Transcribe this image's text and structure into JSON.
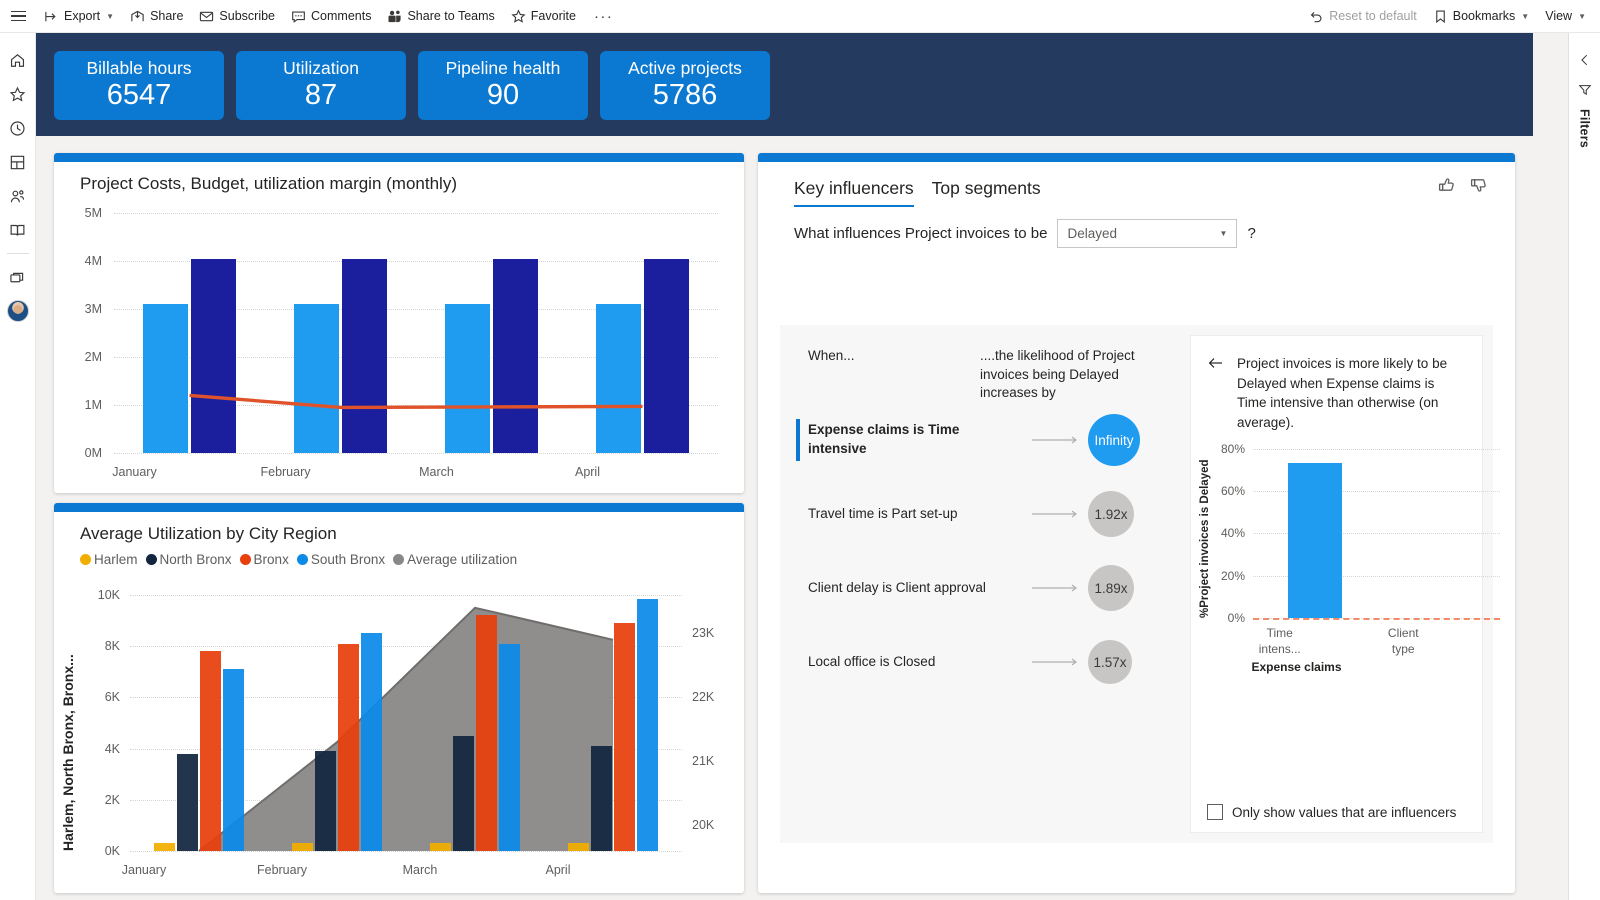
{
  "toolbar": {
    "menu": "menu-hamburger",
    "items": [
      {
        "label": "Export",
        "icon": "export-icon",
        "caret": true
      },
      {
        "label": "Share",
        "icon": "share-icon",
        "caret": false
      },
      {
        "label": "Subscribe",
        "icon": "mail-icon",
        "caret": false
      },
      {
        "label": "Comments",
        "icon": "comment-icon",
        "caret": false
      },
      {
        "label": "Share to Teams",
        "icon": "teams-icon",
        "caret": false
      },
      {
        "label": "Favorite",
        "icon": "star-icon",
        "caret": false
      }
    ],
    "overflow": "···",
    "right_items": [
      {
        "label": "Reset to default",
        "icon": "undo-icon",
        "caret": false,
        "disabled": true
      },
      {
        "label": "Bookmarks",
        "icon": "bookmark-icon",
        "caret": true,
        "disabled": false
      },
      {
        "label": "View",
        "icon": "",
        "caret": true,
        "disabled": false
      }
    ]
  },
  "left_rail": {
    "items": [
      {
        "name": "home-icon"
      },
      {
        "name": "star-icon"
      },
      {
        "name": "clock-icon"
      },
      {
        "name": "apps-icon"
      },
      {
        "name": "shared-people-icon"
      },
      {
        "name": "learn-book-icon"
      },
      {
        "name": "workspaces-icon"
      }
    ],
    "avatar": "user-avatar"
  },
  "right_rail": {
    "collapse": "chevron-left-icon",
    "filter_icon": "filter-funnel-icon",
    "label": "Filters"
  },
  "kpis": [
    {
      "title": "Billable hours",
      "value": "6547"
    },
    {
      "title": "Utilization",
      "value": "87"
    },
    {
      "title": "Pipeline health",
      "value": "90"
    },
    {
      "title": "Active projects",
      "value": "5786"
    }
  ],
  "colors": {
    "banner": "#243a5e",
    "accent": "#0b78d1",
    "kpi_card": "#0b78d1",
    "bar_light_blue": "#1f9cf0",
    "bar_navy": "#1b1f9e",
    "line_orange": "#e0532a",
    "harlem": "#f2ae00",
    "north_bronx": "#12263f",
    "bronx": "#e8400c",
    "south_bronx": "#0b8ae8",
    "average": "#8a8886",
    "bubble_blue": "#1f9cf0",
    "bubble_gray": "#c8c6c4"
  },
  "chart_data": [
    {
      "type": "bar",
      "id": "project-costs",
      "title": "Project Costs, Budget, utilization margin (monthly)",
      "categories": [
        "January",
        "February",
        "March",
        "April"
      ],
      "ylabel": "",
      "xlabel": "",
      "ylim": [
        0,
        5000000
      ],
      "yticks": [
        "0M",
        "1M",
        "2M",
        "3M",
        "4M",
        "5M"
      ],
      "ytick_values": [
        0,
        1000000,
        2000000,
        3000000,
        4000000,
        5000000
      ],
      "grid": true,
      "series": [
        {
          "name": "Project Costs",
          "type": "bar",
          "color": "#1f9cf0",
          "values": [
            3100000,
            3100000,
            3100000,
            3100000
          ]
        },
        {
          "name": "Budget",
          "type": "bar",
          "color": "#1b1f9e",
          "values": [
            4050000,
            4050000,
            4050000,
            4050000
          ]
        },
        {
          "name": "utilization margin",
          "type": "line",
          "color": "#e0532a",
          "values": [
            1200000,
            950000,
            960000,
            970000
          ]
        }
      ]
    },
    {
      "type": "bar",
      "id": "average-utilization",
      "title": "Average Utilization by City Region",
      "categories": [
        "January",
        "February",
        "March",
        "April"
      ],
      "ylabel": "Harlem, North Bronx, Bronx...",
      "xlabel": "",
      "ylim": [
        0,
        10000
      ],
      "yticks": [
        "0K",
        "2K",
        "4K",
        "6K",
        "8K",
        "10K"
      ],
      "ytick_values": [
        0,
        2000,
        4000,
        6000,
        8000,
        10000
      ],
      "y2ticks": [
        "20K",
        "21K",
        "22K",
        "23K"
      ],
      "y2tick_values": [
        20000,
        21000,
        22000,
        23000
      ],
      "y2lim": [
        19600,
        23600
      ],
      "grid": true,
      "legend_position": "top",
      "series": [
        {
          "name": "Harlem",
          "type": "bar",
          "color": "#f2ae00",
          "values": [
            300,
            300,
            300,
            300
          ]
        },
        {
          "name": "North Bronx",
          "type": "bar",
          "color": "#12263f",
          "values": [
            3800,
            3900,
            4500,
            4100
          ]
        },
        {
          "name": "Bronx",
          "type": "bar",
          "color": "#e8400c",
          "values": [
            7800,
            8100,
            9200,
            8900
          ]
        },
        {
          "name": "South Bronx",
          "type": "bar",
          "color": "#0b8ae8",
          "values": [
            7100,
            8500,
            8100,
            9850
          ]
        },
        {
          "name": "Average utilization",
          "type": "area",
          "color": "#8a8886",
          "axis": "y2",
          "values": [
            19600,
            21300,
            23400,
            22900
          ]
        }
      ]
    },
    {
      "type": "bar",
      "id": "influencer-detail",
      "title": "",
      "categories": [
        "Time intens...",
        "Client type"
      ],
      "group_label": "Expense claims",
      "ylabel": "%Project invoices is Delayed",
      "ylim": [
        0,
        85
      ],
      "yticks": [
        "0%",
        "20%",
        "40%",
        "60%",
        "80%"
      ],
      "ytick_values": [
        0,
        20,
        40,
        60,
        80
      ],
      "grid": true,
      "reference_line": {
        "value": 0,
        "color": "#f08c6a",
        "style": "dashed"
      },
      "series": [
        {
          "name": "%Project invoices is Delayed",
          "type": "bar",
          "color": "#1f9cf0",
          "values": [
            73,
            0
          ]
        }
      ]
    }
  ],
  "key_influencers": {
    "tabs": [
      {
        "label": "Key influencers",
        "active": true
      },
      {
        "label": "Top segments",
        "active": false
      }
    ],
    "thumbs_up": "thumbs-up-icon",
    "thumbs_down": "thumbs-down-icon",
    "question_prefix": "What influences Project invoices to be",
    "selected_value": "Delayed",
    "help": "?",
    "col_when": "When...",
    "col_likelihood": "....the likelihood of Project invoices being Delayed increases by",
    "influencers": [
      {
        "label": "Expense claims is Time intensive",
        "value": "Infinity",
        "selected": true,
        "bubble_size": 52
      },
      {
        "label": "Travel time is Part set-up",
        "value": "1.92x",
        "selected": false,
        "bubble_size": 46
      },
      {
        "label": "Client delay is Client approval",
        "value": "1.89x",
        "selected": false,
        "bubble_size": 46
      },
      {
        "label": "Local office is Closed",
        "value": "1.57x",
        "selected": false,
        "bubble_size": 44
      }
    ],
    "detail": {
      "back_icon": "arrow-left-icon",
      "text": "Project invoices is more likely to be Delayed when Expense claims is Time intensive than otherwise (on average).",
      "checkbox_label": "Only show values that are influencers",
      "checkbox_checked": false
    }
  }
}
